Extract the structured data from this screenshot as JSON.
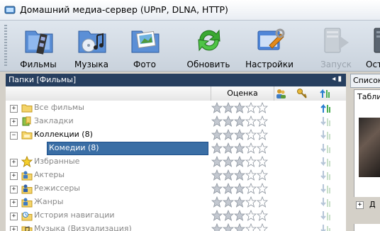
{
  "window": {
    "title": "Домашний медиа-сервер (UPnP, DLNA, HTTP)"
  },
  "toolbar": {
    "buttons": [
      {
        "label": "Фильмы",
        "icon": "film-folder-icon",
        "enabled": true
      },
      {
        "label": "Музыка",
        "icon": "music-folder-icon",
        "enabled": true
      },
      {
        "label": "Фото",
        "icon": "photo-folder-icon",
        "enabled": true
      },
      {
        "label": "Обновить",
        "icon": "refresh-icon",
        "enabled": true
      },
      {
        "label": "Настройки",
        "icon": "settings-icon",
        "enabled": true
      },
      {
        "label": "Запуск",
        "icon": "start-server-icon",
        "enabled": false
      },
      {
        "label": "Ост",
        "icon": "stop-server-icon",
        "enabled": true
      }
    ]
  },
  "folders_panel": {
    "title": "Папки [Фильмы]",
    "columns": {
      "rating": "Оценка"
    },
    "items": [
      {
        "label": "Все фильмы",
        "expander": "+",
        "icon": "folder-icon",
        "indent": 0,
        "rating": 0,
        "selected": false,
        "dark": false
      },
      {
        "label": "Закладки",
        "expander": "+",
        "icon": "bookmarks-icon",
        "indent": 0,
        "rating": 0,
        "selected": false,
        "dark": false
      },
      {
        "label": "Коллекции (8)",
        "expander": "−",
        "icon": "collections-folder-icon",
        "indent": 0,
        "rating": 0,
        "selected": false,
        "dark": true
      },
      {
        "label": "Комедии (8)",
        "expander": "",
        "icon": "package-icon",
        "indent": 1,
        "rating": 0,
        "selected": true,
        "dark": false
      },
      {
        "label": "Избранные",
        "expander": "+",
        "icon": "star-favorites-icon",
        "indent": 0,
        "rating": 0,
        "selected": false,
        "dark": false
      },
      {
        "label": "Актеры",
        "expander": "+",
        "icon": "actors-folder-icon",
        "indent": 0,
        "rating": 0,
        "selected": false,
        "dark": false
      },
      {
        "label": "Режиссеры",
        "expander": "+",
        "icon": "directors-folder-icon",
        "indent": 0,
        "rating": 0,
        "selected": false,
        "dark": false
      },
      {
        "label": "Жанры",
        "expander": "+",
        "icon": "genres-folder-icon",
        "indent": 0,
        "rating": 0,
        "selected": false,
        "dark": false
      },
      {
        "label": "История навигации",
        "expander": "+",
        "icon": "history-folder-icon",
        "indent": 0,
        "rating": 0,
        "selected": false,
        "dark": false
      },
      {
        "label": "Музыка (Визуализация)",
        "expander": "+",
        "icon": "music-folder-icon",
        "indent": 0,
        "rating": 0,
        "selected": false,
        "dark": false
      }
    ]
  },
  "right_panel": {
    "tab_label": "Список",
    "subtab_label": "Таблица",
    "footer_letter": "Д"
  },
  "colors": {
    "selection": "#3a6ea5",
    "panel_header": "#273f5f",
    "star": "#c4c9d1"
  }
}
